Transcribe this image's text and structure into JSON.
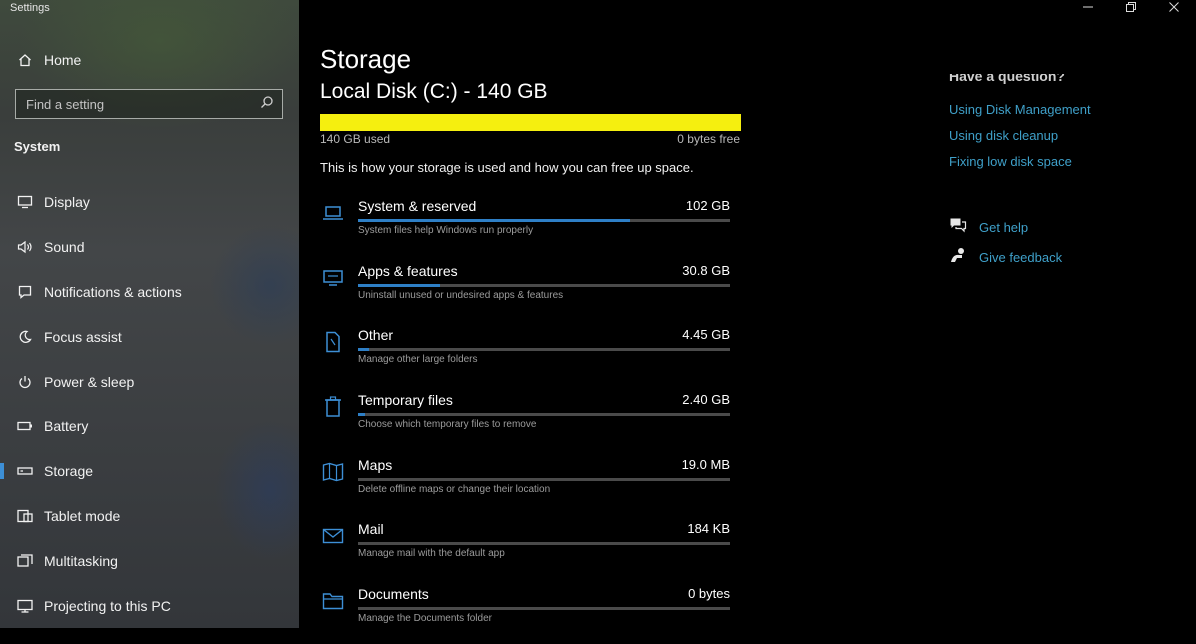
{
  "window": {
    "app_title": "Settings",
    "controls": [
      "minimize-icon",
      "restore-icon",
      "close-icon"
    ]
  },
  "sidebar": {
    "home_label": "Home",
    "search": {
      "placeholder": "Find a setting",
      "value": ""
    },
    "section_header": "System",
    "items": [
      {
        "label": "Display",
        "icon": "monitor-icon"
      },
      {
        "label": "Sound",
        "icon": "speaker-icon"
      },
      {
        "label": "Notifications & actions",
        "icon": "notification-icon"
      },
      {
        "label": "Focus assist",
        "icon": "moon-icon"
      },
      {
        "label": "Power & sleep",
        "icon": "power-icon"
      },
      {
        "label": "Battery",
        "icon": "battery-icon"
      },
      {
        "label": "Storage",
        "icon": "storage-icon",
        "active": true
      },
      {
        "label": "Tablet mode",
        "icon": "tablet-icon"
      },
      {
        "label": "Multitasking",
        "icon": "multitasking-icon"
      },
      {
        "label": "Projecting to this PC",
        "icon": "projector-icon"
      }
    ]
  },
  "main": {
    "title": "Storage",
    "disk": {
      "title": "Local Disk (C:) - 140 GB",
      "used_label": "140 GB used",
      "free_label": "0 bytes free",
      "used_fraction": 1.0,
      "bar_color": "#f5ef0f"
    },
    "intro": "This is how your storage is used and how you can free up space.",
    "categories": [
      {
        "name": "System & reserved",
        "size": "102 GB",
        "desc": "System files help Windows run properly",
        "fraction": 0.73,
        "icon": "laptop-icon"
      },
      {
        "name": "Apps & features",
        "size": "30.8 GB",
        "desc": "Uninstall unused or undesired apps & features",
        "fraction": 0.22,
        "icon": "apps-icon"
      },
      {
        "name": "Other",
        "size": "4.45 GB",
        "desc": "Manage other large folders",
        "fraction": 0.03,
        "icon": "document-icon"
      },
      {
        "name": "Temporary files",
        "size": "2.40 GB",
        "desc": "Choose which temporary files to remove",
        "fraction": 0.02,
        "icon": "trash-icon"
      },
      {
        "name": "Maps",
        "size": "19.0 MB",
        "desc": "Delete offline maps or change their location",
        "fraction": 0.0,
        "icon": "map-icon"
      },
      {
        "name": "Mail",
        "size": "184 KB",
        "desc": "Manage mail with the default app",
        "fraction": 0.0,
        "icon": "mail-icon"
      },
      {
        "name": "Documents",
        "size": "0 bytes",
        "desc": "Manage the Documents folder",
        "fraction": 0.0,
        "icon": "folder-icon"
      }
    ],
    "accent_color": "#2e7fc6"
  },
  "related": {
    "heading": "Have a question?",
    "links": [
      "Using Disk Management",
      "Using disk cleanup",
      "Fixing low disk space"
    ],
    "help": [
      {
        "label": "Get help",
        "icon": "chat-help-icon"
      },
      {
        "label": "Give feedback",
        "icon": "feedback-icon"
      }
    ],
    "link_color": "#3fa0c9"
  }
}
